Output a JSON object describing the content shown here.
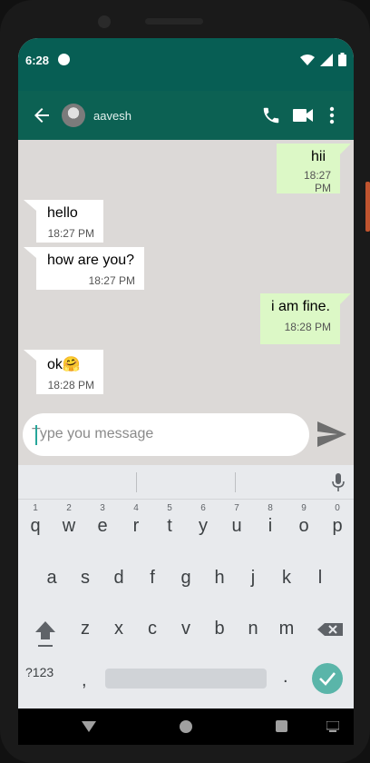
{
  "status_bar": {
    "time": "6:28"
  },
  "header": {
    "contact_name": "aavesh"
  },
  "messages": [
    {
      "direction": "out",
      "text": "hii",
      "time": "18:27 PM"
    },
    {
      "direction": "in",
      "text": "hello",
      "time": "18:27 PM"
    },
    {
      "direction": "in",
      "text": "how are you?",
      "time": "18:27 PM"
    },
    {
      "direction": "out",
      "text": "i am fine.",
      "time": "18:28 PM"
    },
    {
      "direction": "in",
      "text": "ok🤗",
      "time": "18:28 PM"
    }
  ],
  "composer": {
    "placeholder": "Type you message",
    "value": ""
  },
  "keyboard": {
    "row1": [
      {
        "ch": "q",
        "num": "1"
      },
      {
        "ch": "w",
        "num": "2"
      },
      {
        "ch": "e",
        "num": "3"
      },
      {
        "ch": "r",
        "num": "4"
      },
      {
        "ch": "t",
        "num": "5"
      },
      {
        "ch": "y",
        "num": "6"
      },
      {
        "ch": "u",
        "num": "7"
      },
      {
        "ch": "i",
        "num": "8"
      },
      {
        "ch": "o",
        "num": "9"
      },
      {
        "ch": "p",
        "num": "0"
      }
    ],
    "row2": [
      "a",
      "s",
      "d",
      "f",
      "g",
      "h",
      "j",
      "k",
      "l"
    ],
    "row3": [
      "z",
      "x",
      "c",
      "v",
      "b",
      "n",
      "m"
    ],
    "symbols_label": "?123",
    "comma": ",",
    "period": "."
  },
  "colors": {
    "header_bg": "#0c6153",
    "status_bg": "#075e54",
    "outgoing_bubble": "#dcf8c6",
    "incoming_bubble": "#ffffff",
    "chat_bg": "#dcd9d7",
    "enter_key": "#5ab5a9"
  }
}
